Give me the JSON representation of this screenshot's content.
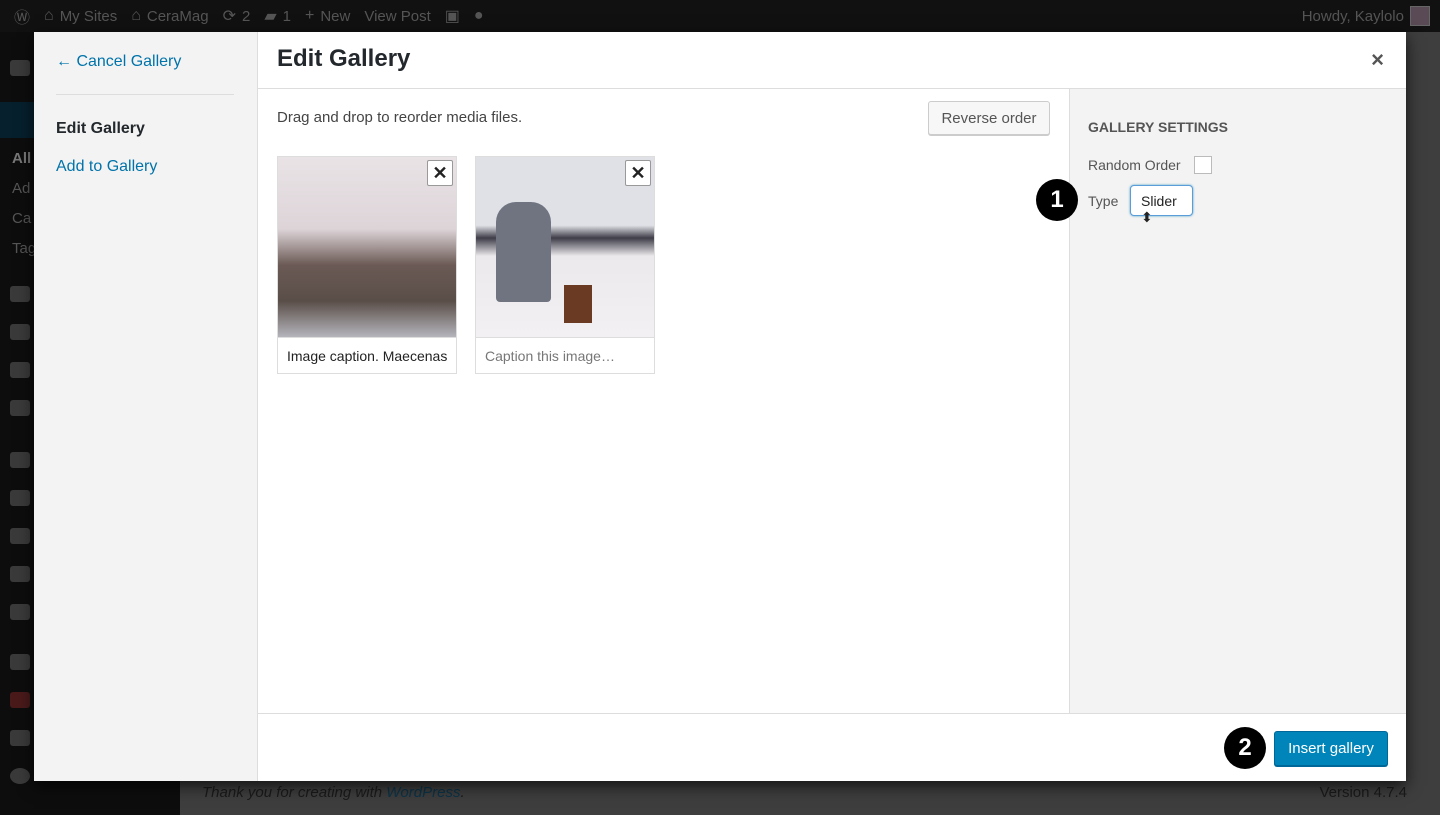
{
  "adminbar": {
    "items": [
      {
        "icon": "wordpress-icon",
        "label": ""
      },
      {
        "icon": "my-sites-icon",
        "label": "My Sites"
      },
      {
        "icon": "home-icon",
        "label": "CeraMag"
      },
      {
        "icon": "updates-icon",
        "label": "2"
      },
      {
        "icon": "comments-icon",
        "label": "1"
      },
      {
        "icon": "plus-icon",
        "label": "New"
      },
      {
        "icon": "",
        "label": "View Post"
      }
    ],
    "howdy": "Howdy, Kaylolo"
  },
  "adminmenu": {
    "submenu": [
      "All",
      "Ad",
      "Ca",
      "Tag"
    ]
  },
  "footer": {
    "thanks": "Thank you for creating with ",
    "link": "WordPress",
    "period": ".",
    "version": "Version 4.7.4"
  },
  "modal": {
    "menu": {
      "cancel": "← Cancel Gallery",
      "edit": "Edit Gallery",
      "add": "Add to Gallery"
    },
    "title": "Edit Gallery",
    "close": "×",
    "hint": "Drag and drop to reorder media files.",
    "reverse": "Reverse order",
    "attachments": [
      {
        "caption": "Image caption. Maecenas",
        "placeholder": ""
      },
      {
        "caption": "",
        "placeholder": "Caption this image…"
      }
    ],
    "settings": {
      "heading": "GALLERY SETTINGS",
      "random_label": "Random Order",
      "random_checked": false,
      "type_label": "Type",
      "type_value": "Slider ⬍"
    },
    "insert": "Insert gallery"
  },
  "badges": [
    "1",
    "2"
  ],
  "colors": {
    "primary": "#0085ba",
    "link": "#0073aa"
  }
}
